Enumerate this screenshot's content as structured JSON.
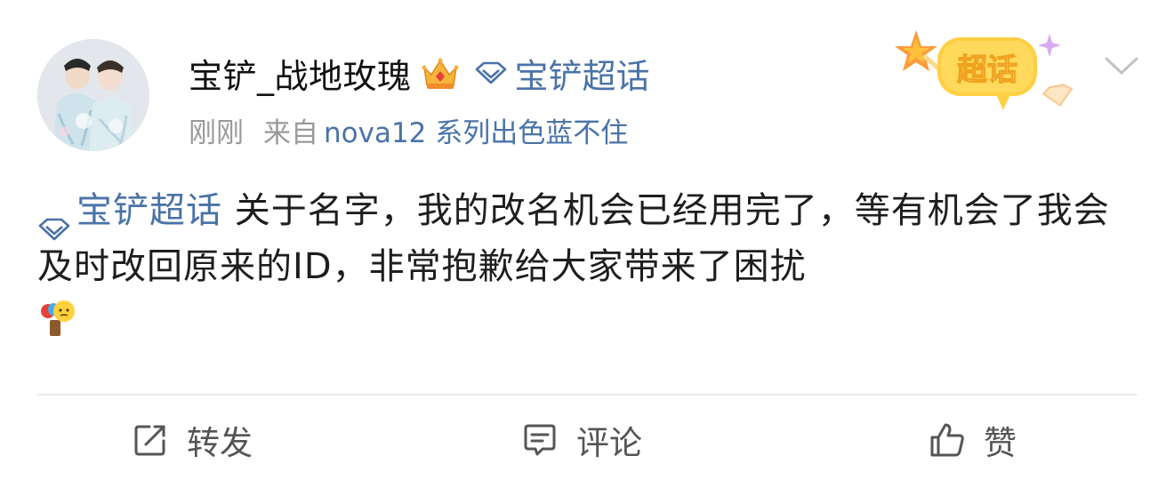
{
  "post": {
    "username": "宝铲_战地玫瑰",
    "super_topic_link": "宝铲超话",
    "timestamp": "刚刚",
    "source_prefix": "来自",
    "source_device": "nova12 系列出色蓝不住",
    "badge_text": "超话",
    "content_topic": "宝铲超话",
    "content_text": " 关于名字，我的改名机会已经用完了，等有机会了我会及时改回原来的ID，非常抱歉给大家带来了困扰"
  },
  "actions": {
    "repost_label": "转发",
    "comment_label": "评论",
    "like_label": "赞"
  },
  "icons": {
    "avatar": "avatar-photo",
    "crown": "crown-icon",
    "diamond": "diamond-icon",
    "badge": "super-topic-badge",
    "chevron": "chevron-down-icon",
    "emoji": "emoji-icon",
    "repost": "repost-icon",
    "comment": "comment-icon",
    "like": "thumbs-up-icon"
  },
  "colors": {
    "link": "#4a73a8",
    "meta": "#9a9a9a",
    "badge": "#ffc93c"
  }
}
